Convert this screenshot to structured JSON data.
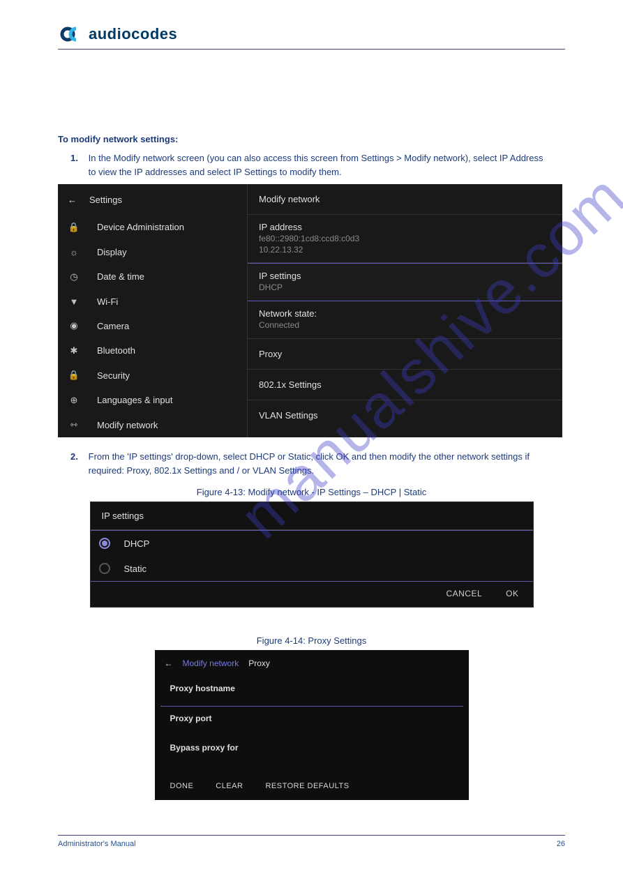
{
  "brand": {
    "name": "audiocodes"
  },
  "instructions": {
    "intro": "To modify network settings:",
    "step1_num": "1.",
    "step1_body": "In the Modify network screen (you can also access this screen from Settings > Modify network), select IP Address to view the IP addresses and select IP Settings to modify them.",
    "fig_caption_4_13": "Figure 4-13:  Modify network - IP Settings – DHCP | Static",
    "fig_caption_4_14": "Figure 4-14:  Proxy Settings",
    "step2_num": "2.",
    "step2_body": "From the 'IP settings' drop-down, select DHCP or Static, click OK and then modify the other network settings if required: Proxy, 802.1x Settings and / or VLAN Settings."
  },
  "settings_shot": {
    "back_label": "Settings",
    "left_items": [
      {
        "icon": "🔒",
        "label": "Device Administration"
      },
      {
        "icon": "☼",
        "label": "Display"
      },
      {
        "icon": "◷",
        "label": "Date & time"
      },
      {
        "icon": "▼",
        "label": "Wi-Fi"
      },
      {
        "icon": "◉",
        "label": "Camera"
      },
      {
        "icon": "✱",
        "label": "Bluetooth"
      },
      {
        "icon": "🔒",
        "label": "Security"
      },
      {
        "icon": "⊕",
        "label": "Languages & input"
      },
      {
        "icon": "⇿",
        "label": "Modify network"
      }
    ],
    "right_title": "Modify network",
    "ip_address_label": "IP address",
    "ip_address_value": "fe80::2980:1cd8:ccd8:c0d3\n10.22.13.32",
    "ip_settings_label": "IP settings",
    "ip_settings_value": "DHCP",
    "net_state_label": "Network state:",
    "net_state_value": "Connected",
    "proxy_label": "Proxy",
    "dot1x_label": "802.1x Settings",
    "vlan_label": "VLAN Settings"
  },
  "ip_dialog": {
    "title": "IP settings",
    "option_dhcp": "DHCP",
    "option_static": "Static",
    "cancel": "CANCEL",
    "ok": "OK"
  },
  "proxy_shot": {
    "crumb_link": "Modify network",
    "crumb_current": "Proxy",
    "hostname_label": "Proxy hostname",
    "port_label": "Proxy port",
    "bypass_label": "Bypass proxy for",
    "done": "DONE",
    "clear": "CLEAR",
    "restore": "RESTORE DEFAULTS"
  },
  "footer": {
    "left": "Administrator's Manual",
    "right": "26"
  },
  "watermark": "manualshive.com"
}
